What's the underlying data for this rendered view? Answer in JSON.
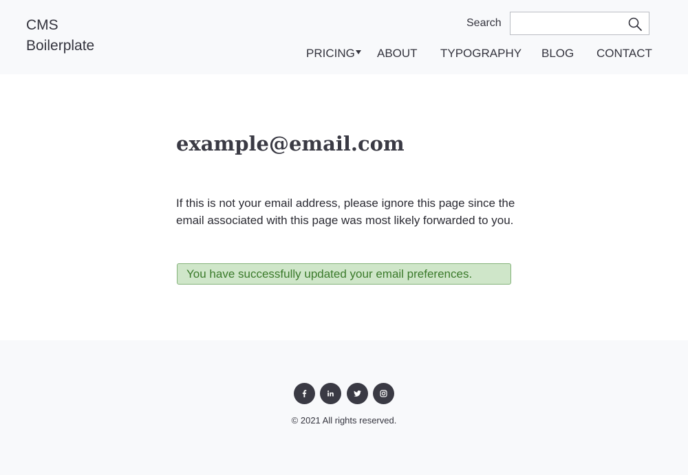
{
  "header": {
    "logo_line1": "CMS",
    "logo_line2": "Boilerplate",
    "search_label": "Search",
    "search_placeholder": "",
    "search_icon": "search-icon"
  },
  "nav": {
    "pricing": "PRICING",
    "about": "ABOUT",
    "typography": "TYPOGRAPHY",
    "blog": "BLOG",
    "contact": "CONTACT"
  },
  "main": {
    "title": "example@email.com",
    "message": "If this is not your email address, please ignore this page since the email associated with this page was most likely forwarded to you.",
    "success": "You have successfully updated your email preferences."
  },
  "footer": {
    "social": [
      "facebook-icon",
      "linkedin-icon",
      "twitter-icon",
      "instagram-icon"
    ],
    "copyright": "© 2021 All rights reserved."
  },
  "colors": {
    "header_bg": "#f8f9fb",
    "text": "#33333d",
    "success_bg": "#cfe6c9",
    "success_border": "#84b27a",
    "success_text": "#3a7a2a",
    "social_bg": "#3a3a44"
  }
}
